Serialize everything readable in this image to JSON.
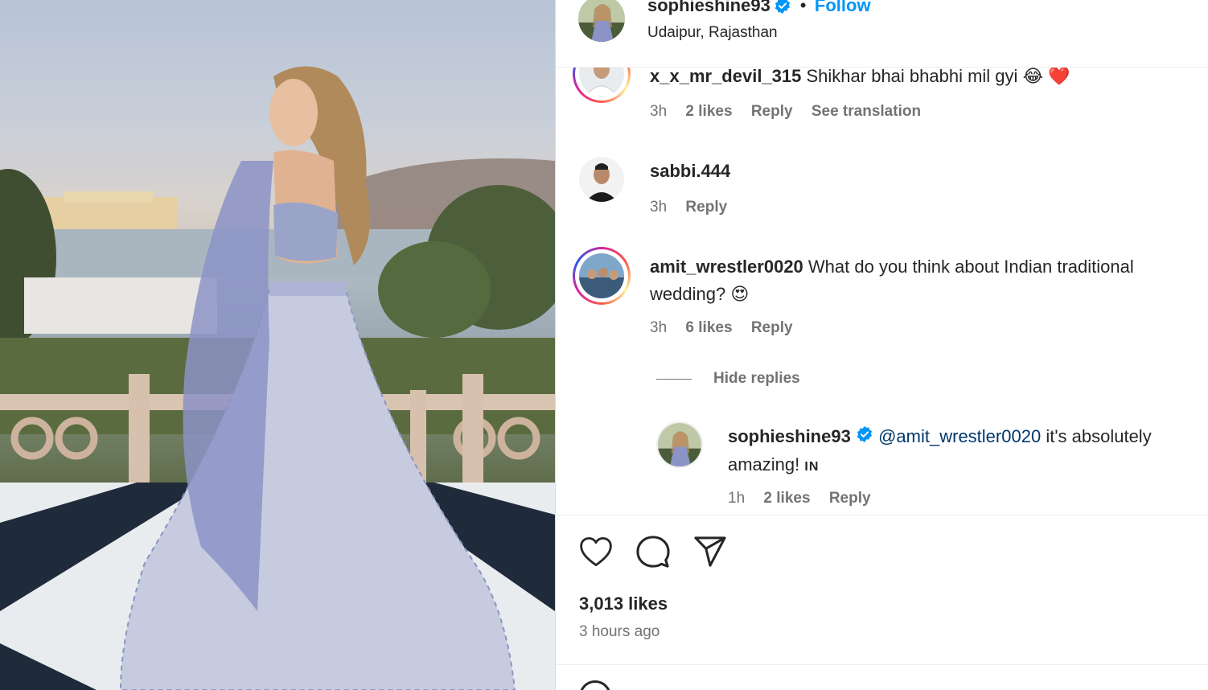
{
  "post": {
    "author": "sophieshine93",
    "follow_label": "Follow",
    "separator": "•",
    "location": "Udaipur, Rajasthan",
    "likes": "3,013 likes",
    "time_ago": "3 hours ago"
  },
  "comments": [
    {
      "username": "x_x_mr_devil_315",
      "text": "Shikhar bhai bhabhi mil gyi",
      "emojis": "😂 ❤️",
      "time": "3h",
      "likes": "2 likes",
      "reply_label": "Reply",
      "translate_label": "See translation"
    },
    {
      "username": "sabbi.444",
      "text": "",
      "time": "3h",
      "reply_label": "Reply"
    },
    {
      "username": "amit_wrestler0020",
      "text": "What do you think about Indian traditional wedding?",
      "emojis": "😍",
      "time": "3h",
      "likes": "6 likes",
      "reply_label": "Reply"
    }
  ],
  "hide_replies_label": "Hide replies",
  "reply": {
    "username": "sophieshine93",
    "mention": "@amit_wrestler0020",
    "text": "it's absolutely amazing!",
    "flag": "IN",
    "time": "1h",
    "likes": "2 likes",
    "reply_label": "Reply"
  },
  "icons": {
    "like": "heart-icon",
    "comment": "comment-icon",
    "share": "share-icon",
    "verified": "verified-badge-icon"
  },
  "colors": {
    "link_blue": "#0095f6",
    "verified_blue": "#0095f6",
    "text": "#262626",
    "secondary": "#737373"
  }
}
